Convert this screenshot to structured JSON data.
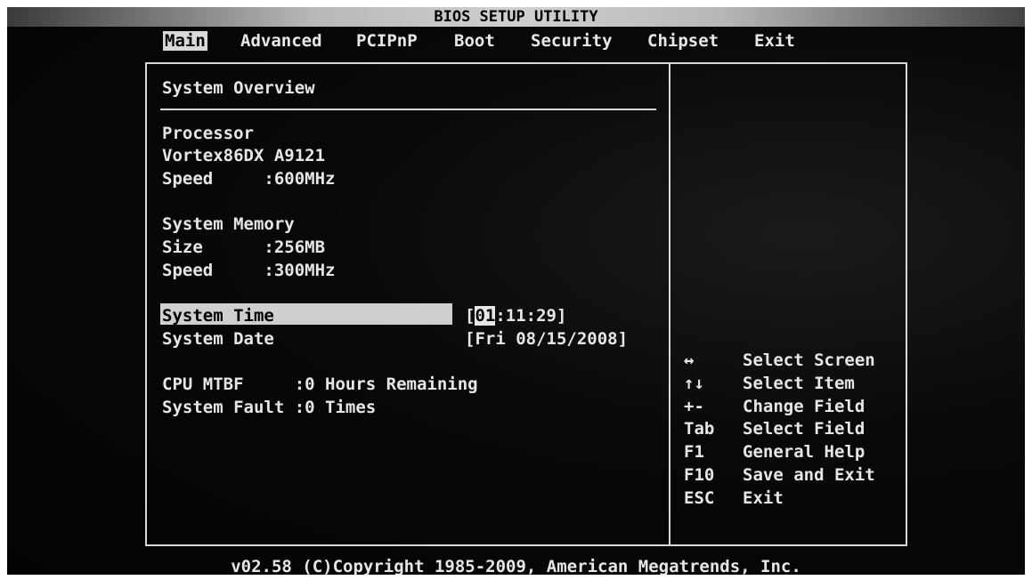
{
  "title": "BIOS SETUP UTILITY",
  "menu": [
    {
      "label": "Main",
      "active": true
    },
    {
      "label": "Advanced"
    },
    {
      "label": "PCIPnP"
    },
    {
      "label": "Boot"
    },
    {
      "label": "Security"
    },
    {
      "label": "Chipset"
    },
    {
      "label": "Exit"
    }
  ],
  "overview": {
    "heading": "System Overview",
    "processor_heading": "Processor",
    "processor_name": "Vortex86DX A9121",
    "processor_speed": "Speed     :600MHz",
    "memory_heading": "System Memory",
    "memory_size": "Size      :256MB",
    "memory_speed": "Speed     :300MHz",
    "time_label": "System Time",
    "time_open": "[",
    "time_cursor": "01",
    "time_rest": ":11:29]",
    "date_label": "System Date",
    "date_value": "[Fri 08/15/2008]",
    "cpu_mtbf": "CPU MTBF     :0 Hours Remaining",
    "system_fault": "System Fault :0 Times"
  },
  "help": [
    {
      "key": "↔",
      "desc": "Select Screen"
    },
    {
      "key": "↑↓",
      "desc": "Select Item"
    },
    {
      "key": "+-",
      "desc": "Change Field"
    },
    {
      "key": "Tab",
      "desc": "Select Field"
    },
    {
      "key": "F1",
      "desc": "General Help"
    },
    {
      "key": "F10",
      "desc": "Save and Exit"
    },
    {
      "key": "ESC",
      "desc": "Exit"
    }
  ],
  "copyright": "v02.58 (C)Copyright 1985-2009, American Megatrends, Inc."
}
